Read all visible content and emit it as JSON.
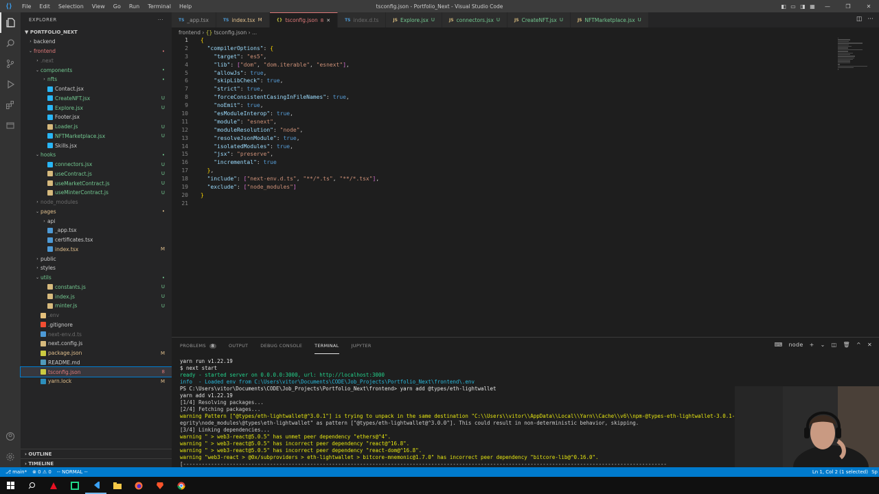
{
  "window": {
    "title": "tsconfig.json - Portfolio_Next - Visual Studio Code",
    "menu": [
      "File",
      "Edit",
      "Selection",
      "View",
      "Go",
      "Run",
      "Terminal",
      "Help"
    ]
  },
  "explorer": {
    "header": "EXPLORER",
    "root": "PORTFOLIO_NEXT",
    "items": [
      {
        "label": "backend",
        "indent": 1,
        "type": "folder",
        "open": false,
        "color": "#cccccc",
        "badge": ""
      },
      {
        "label": "frontend",
        "indent": 1,
        "type": "folder",
        "open": true,
        "color": "#e07a7a",
        "badge": "•"
      },
      {
        "label": ".next",
        "indent": 2,
        "type": "folder",
        "open": false,
        "color": "#6b6b6b",
        "badge": ""
      },
      {
        "label": "components",
        "indent": 2,
        "type": "folder",
        "open": true,
        "color": "#73c991",
        "badge": "•"
      },
      {
        "label": "nfts",
        "indent": 3,
        "type": "folder",
        "open": false,
        "color": "#73c991",
        "badge": "•"
      },
      {
        "label": "Contact.jsx",
        "indent": 3,
        "type": "file",
        "color": "#cccccc",
        "icon": "#29b6f6",
        "badge": ""
      },
      {
        "label": "CreateNFT.jsx",
        "indent": 3,
        "type": "file",
        "color": "#73c991",
        "icon": "#29b6f6",
        "badge": "U"
      },
      {
        "label": "Explore.jsx",
        "indent": 3,
        "type": "file",
        "color": "#73c991",
        "icon": "#29b6f6",
        "badge": "U"
      },
      {
        "label": "Footer.jsx",
        "indent": 3,
        "type": "file",
        "color": "#cccccc",
        "icon": "#29b6f6",
        "badge": ""
      },
      {
        "label": "Loader.js",
        "indent": 3,
        "type": "file",
        "color": "#73c991",
        "icon": "#d7ba7d",
        "badge": "U"
      },
      {
        "label": "NFTMarketplace.jsx",
        "indent": 3,
        "type": "file",
        "color": "#73c991",
        "icon": "#29b6f6",
        "badge": "U"
      },
      {
        "label": "Skills.jsx",
        "indent": 3,
        "type": "file",
        "color": "#cccccc",
        "icon": "#29b6f6",
        "badge": ""
      },
      {
        "label": "hooks",
        "indent": 2,
        "type": "folder",
        "open": true,
        "color": "#73c991",
        "badge": "•"
      },
      {
        "label": "connectors.jsx",
        "indent": 3,
        "type": "file",
        "color": "#73c991",
        "icon": "#29b6f6",
        "badge": "U"
      },
      {
        "label": "useContract.js",
        "indent": 3,
        "type": "file",
        "color": "#73c991",
        "icon": "#d7ba7d",
        "badge": "U"
      },
      {
        "label": "useMarketContract.js",
        "indent": 3,
        "type": "file",
        "color": "#73c991",
        "icon": "#d7ba7d",
        "badge": "U"
      },
      {
        "label": "useMinterContract.js",
        "indent": 3,
        "type": "file",
        "color": "#73c991",
        "icon": "#d7ba7d",
        "badge": "U"
      },
      {
        "label": "node_modules",
        "indent": 2,
        "type": "folder",
        "open": false,
        "color": "#6b6b6b",
        "badge": ""
      },
      {
        "label": "pages",
        "indent": 2,
        "type": "folder",
        "open": true,
        "color": "#e2c08d",
        "badge": "•"
      },
      {
        "label": "api",
        "indent": 3,
        "type": "folder",
        "open": false,
        "color": "#cccccc",
        "badge": ""
      },
      {
        "label": "_app.tsx",
        "indent": 3,
        "type": "file",
        "color": "#cccccc",
        "icon": "#4d9ad6",
        "badge": ""
      },
      {
        "label": "certificates.tsx",
        "indent": 3,
        "type": "file",
        "color": "#cccccc",
        "icon": "#4d9ad6",
        "badge": ""
      },
      {
        "label": "index.tsx",
        "indent": 3,
        "type": "file",
        "color": "#e2c08d",
        "icon": "#4d9ad6",
        "badge": "M"
      },
      {
        "label": "public",
        "indent": 2,
        "type": "folder",
        "open": false,
        "color": "#cccccc",
        "badge": ""
      },
      {
        "label": "styles",
        "indent": 2,
        "type": "folder",
        "open": false,
        "color": "#cccccc",
        "badge": ""
      },
      {
        "label": "utils",
        "indent": 2,
        "type": "folder",
        "open": true,
        "color": "#73c991",
        "badge": "•"
      },
      {
        "label": "constants.js",
        "indent": 3,
        "type": "file",
        "color": "#73c991",
        "icon": "#d7ba7d",
        "badge": "U"
      },
      {
        "label": "index.js",
        "indent": 3,
        "type": "file",
        "color": "#73c991",
        "icon": "#d7ba7d",
        "badge": "U"
      },
      {
        "label": "minter.js",
        "indent": 3,
        "type": "file",
        "color": "#73c991",
        "icon": "#d7ba7d",
        "badge": "U"
      },
      {
        "label": ".env",
        "indent": 2,
        "type": "file",
        "color": "#6b6b6b",
        "icon": "#e5c07b",
        "badge": ""
      },
      {
        "label": ".gitignore",
        "indent": 2,
        "type": "file",
        "color": "#cccccc",
        "icon": "#f14e32",
        "badge": ""
      },
      {
        "label": "next-env.d.ts",
        "indent": 2,
        "type": "file",
        "color": "#6b6b6b",
        "icon": "#4d9ad6",
        "badge": ""
      },
      {
        "label": "next.config.js",
        "indent": 2,
        "type": "file",
        "color": "#cccccc",
        "icon": "#d7ba7d",
        "badge": ""
      },
      {
        "label": "package.json",
        "indent": 2,
        "type": "file",
        "color": "#e2c08d",
        "icon": "#cbcb41",
        "badge": "M"
      },
      {
        "label": "README.md",
        "indent": 2,
        "type": "file",
        "color": "#cccccc",
        "icon": "#519aba",
        "badge": ""
      },
      {
        "label": "tsconfig.json",
        "indent": 2,
        "type": "file",
        "color": "#e07a7a",
        "icon": "#cbcb41",
        "badge": "8",
        "selected": true
      },
      {
        "label": "yarn.lock",
        "indent": 2,
        "type": "file",
        "color": "#e2c08d",
        "icon": "#2c8ebb",
        "badge": "M"
      }
    ],
    "outline": "OUTLINE",
    "timeline": "TIMELINE"
  },
  "tabs": [
    {
      "prefix": "TS",
      "label": "_app.tsx",
      "status": "",
      "color": "#969696"
    },
    {
      "prefix": "TS",
      "label": "index.tsx",
      "status": "M",
      "color": "#e2c08d"
    },
    {
      "prefix": "{}",
      "label": "tsconfig.json",
      "status": "8",
      "color": "#e07a7a",
      "active": true
    },
    {
      "prefix": "TS",
      "label": "index.d.ts",
      "status": "",
      "color": "#6b6b6b"
    },
    {
      "prefix": "JS",
      "label": "Explore.jsx",
      "status": "U",
      "color": "#73c991"
    },
    {
      "prefix": "JS",
      "label": "connectors.jsx",
      "status": "U",
      "color": "#73c991"
    },
    {
      "prefix": "JS",
      "label": "CreateNFT.jsx",
      "status": "U",
      "color": "#73c991"
    },
    {
      "prefix": "JS",
      "label": "NFTMarketplace.jsx",
      "status": "U",
      "color": "#73c991"
    }
  ],
  "breadcrumb": [
    "frontend",
    "tsconfig.json",
    "..."
  ],
  "code": [
    "{",
    "  \"compilerOptions\": {",
    "    \"target\": \"es5\",",
    "    \"lib\": [\"dom\", \"dom.iterable\", \"esnext\"],",
    "    \"allowJs\": true,",
    "    \"skipLibCheck\": true,",
    "    \"strict\": true,",
    "    \"forceConsistentCasingInFileNames\": true,",
    "    \"noEmit\": true,",
    "    \"esModuleInterop\": true,",
    "    \"module\": \"esnext\",",
    "    \"moduleResolution\": \"node\",",
    "    \"resolveJsonModule\": true,",
    "    \"isolatedModules\": true,",
    "    \"jsx\": \"preserve\",",
    "    \"incremental\": true",
    "  },",
    "  \"include\": [\"next-env.d.ts\", \"**/*.ts\", \"**/*.tsx\"],",
    "  \"exclude\": [\"node_modules\"]",
    "}",
    ""
  ],
  "panel": {
    "tabs": [
      "PROBLEMS",
      "OUTPUT",
      "DEBUG CONSOLE",
      "TERMINAL",
      "JUPYTER"
    ],
    "problems_count": "8",
    "terminal_name": "node",
    "lines": [
      {
        "t": "yarn run v1.22.19",
        "c": "w"
      },
      {
        "t": "$ next start",
        "c": "w"
      },
      {
        "t": "ready - started server on 0.0.0.0:3000, url: http://localhost:3000",
        "c": "g"
      },
      {
        "t": "info  - Loaded env from C:\\Users\\vitor\\Documents\\CODE\\Job_Projects\\Portfolio_Next\\frontend\\.env",
        "c": "c"
      },
      {
        "t": "PS C:\\Users\\vitor\\Documents\\CODE\\Job_Projects\\Portfolio_Next\\frontend> yarn add @types/eth-lightwallet",
        "c": "w"
      },
      {
        "t": "yarn add v1.22.19",
        "c": "w"
      },
      {
        "t": "[1/4] Resolving packages...",
        "c": "n"
      },
      {
        "t": "[2/4] Fetching packages...",
        "c": "n"
      },
      {
        "t": "warning Pattern [\"@types/eth-lightwallet@^3.0.1\"] is trying to unpack in the same destination \"C:\\\\Users\\\\vitor\\\\AppData\\\\Local\\\\Yarn\\\\Cache\\\\v6\\\\npm-@types-eth-lightwallet-3.0.1-",
        "c": "y"
      },
      {
        "t": "egrity\\node_modules\\@types\\eth-lightwallet\" as pattern [\"@types/eth-lightwallet@^3.0.0\"]. This could result in non-deterministic behavior, skipping.",
        "c": "n"
      },
      {
        "t": "[3/4] Linking dependencies...",
        "c": "n"
      },
      {
        "t": "warning \" > web3-react@5.0.5\" has unmet peer dependency \"ethers@^4\".",
        "c": "y"
      },
      {
        "t": "warning \" > web3-react@5.0.5\" has incorrect peer dependency \"react@^16.8\".",
        "c": "y"
      },
      {
        "t": "warning \" > web3-react@5.0.5\" has incorrect peer dependency \"react-dom@^16.8\".",
        "c": "y"
      },
      {
        "t": "warning \"web3-react > @0x/subproviders > eth-lightwallet > bitcore-mnemonic@1.7.0\" has incorrect peer dependency \"bitcore-lib@^0.16.0\".",
        "c": "y"
      },
      {
        "t": "[------------------------------------------------------------------------------------------------------------------------------------------------------------",
        "c": "n"
      }
    ]
  },
  "statusbar": {
    "branch": "main*",
    "problems": "⊗ 0 ⚠ 0",
    "mode": "-- NORMAL --",
    "position": "Ln 1, Col 2 (1 selected)",
    "spaces": "Sp"
  },
  "colors": {
    "accent": "#007acc",
    "modified": "#e2c08d",
    "untracked": "#73c991",
    "error": "#e07a7a"
  }
}
